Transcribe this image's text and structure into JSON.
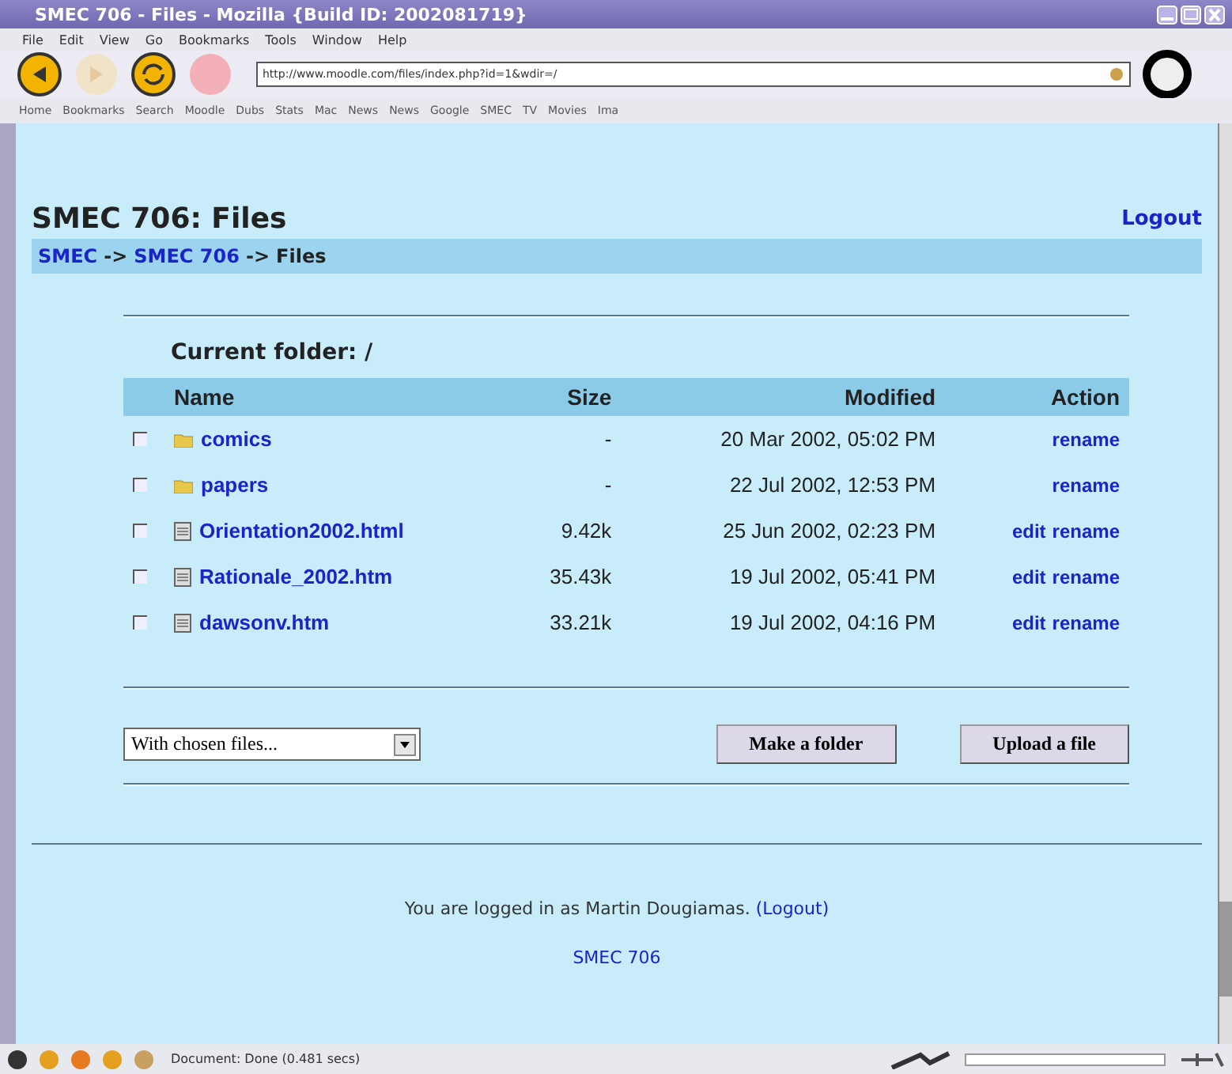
{
  "window": {
    "title": "SMEC 706 - Files - Mozilla {Build ID: 2002081719}"
  },
  "menu": [
    "File",
    "Edit",
    "View",
    "Go",
    "Bookmarks",
    "Tools",
    "Window",
    "Help"
  ],
  "address": {
    "value": "http://www.moodle.com/files/index.php?id=1&wdir=/"
  },
  "bookmarks": [
    "Home",
    "Bookmarks",
    "Search",
    "Moodle",
    "Dubs",
    "Stats",
    "Mac",
    "News",
    "News",
    "Google",
    "SMEC",
    "TV",
    "Movies",
    "Ima"
  ],
  "page": {
    "title": "SMEC 706: Files",
    "logout": "Logout",
    "breadcrumb": [
      {
        "text": "SMEC",
        "link": true
      },
      {
        "text": "->",
        "link": false
      },
      {
        "text": "SMEC 706",
        "link": true
      },
      {
        "text": "->",
        "link": false
      },
      {
        "text": "Files",
        "link": false
      }
    ],
    "current_folder": "Current folder: /",
    "table": {
      "columns": [
        "Name",
        "Size",
        "Modified",
        "Action"
      ],
      "rows": [
        {
          "kind": "folder",
          "checked": false,
          "name": "comics",
          "size": "-",
          "modified": "20 Mar 2002, 05:02 PM",
          "actions": [
            "rename"
          ]
        },
        {
          "kind": "folder",
          "checked": false,
          "name": "papers",
          "size": "-",
          "modified": "22 Jul 2002, 12:53 PM",
          "actions": [
            "rename"
          ]
        },
        {
          "kind": "file",
          "checked": false,
          "name": "Orientation2002.html",
          "size": "9.42k",
          "modified": "25 Jun 2002, 02:23 PM",
          "actions": [
            "edit",
            "rename"
          ]
        },
        {
          "kind": "file",
          "checked": false,
          "name": "Rationale_2002.htm",
          "size": "35.43k",
          "modified": "19 Jul 2002, 05:41 PM",
          "actions": [
            "edit",
            "rename"
          ]
        },
        {
          "kind": "file",
          "checked": false,
          "name": "dawsonv.htm",
          "size": "33.21k",
          "modified": "19 Jul 2002, 04:16 PM",
          "actions": [
            "edit",
            "rename"
          ]
        }
      ]
    },
    "with_chosen": "With chosen files...",
    "buttons": [
      "Make a folder",
      "Upload a file"
    ],
    "footer": {
      "text": "You are logged in as Martin Dougiamas.",
      "logout": "(Logout)",
      "course": "SMEC 706"
    }
  },
  "status_bar": {
    "text": "Document: Done (0.481 secs)"
  }
}
